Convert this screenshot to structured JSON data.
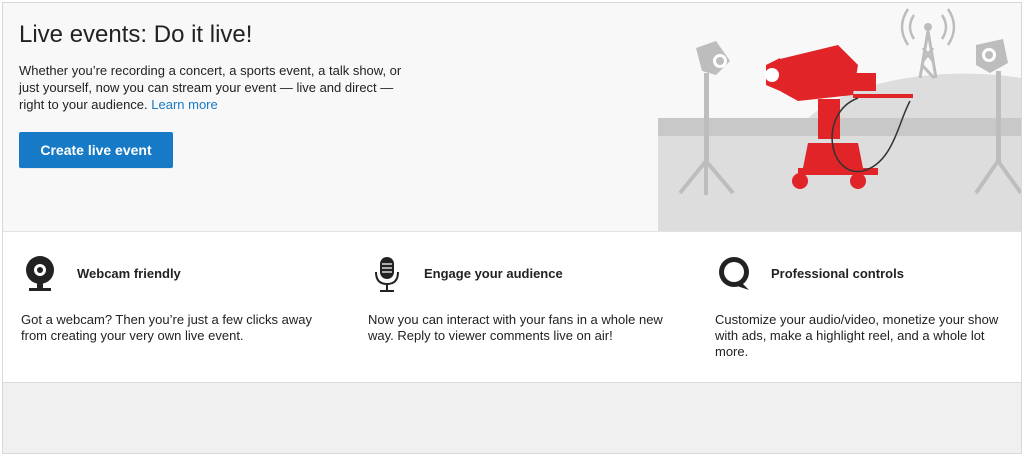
{
  "hero": {
    "title": "Live events: Do it live!",
    "description": "Whether you’re recording a concert, a sports event, a talk show, or just yourself, now you can stream your event — live and direct — right to your audience.",
    "learn_more": "Learn more",
    "create_button": "Create live event"
  },
  "features": [
    {
      "icon": "webcam-icon",
      "title": "Webcam friendly",
      "description": "Got a webcam? Then you’re just a few clicks away from creating your very own live event."
    },
    {
      "icon": "microphone-icon",
      "title": "Engage your audience",
      "description": "Now you can interact with your fans in a whole new way. Reply to viewer comments live on air!"
    },
    {
      "icon": "chat-bubble-icon",
      "title": "Professional controls",
      "description": "Customize your audio/video, monetize your show with ads, make a highlight reel, and a whole lot more."
    }
  ],
  "colors": {
    "accent": "#167ac6",
    "camera_red": "#e02427",
    "illustration_gray": "#c8c8c8"
  }
}
